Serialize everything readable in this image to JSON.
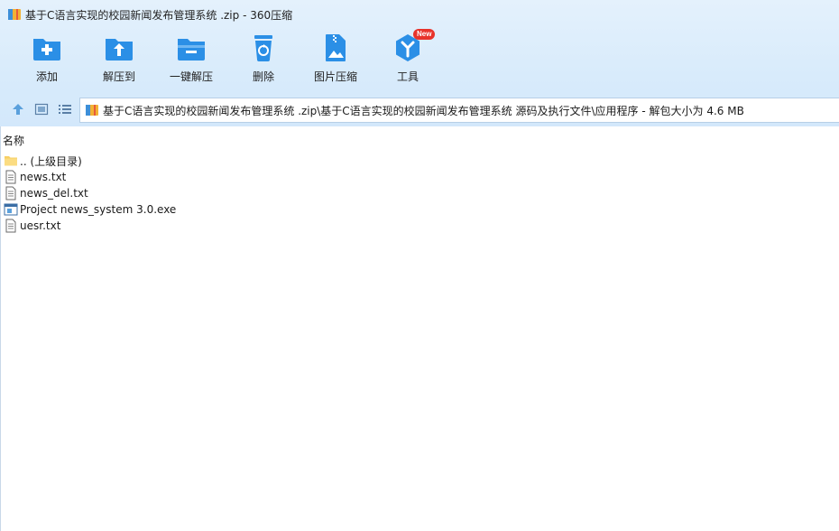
{
  "window": {
    "title": "基于C语言实现的校园新闻发布管理系统 .zip - 360压缩",
    "app_icon": "archive-app-icon"
  },
  "toolbar": {
    "items": [
      {
        "label": "添加",
        "icon": "add-folder-icon"
      },
      {
        "label": "解压到",
        "icon": "extract-to-icon"
      },
      {
        "label": "一键解压",
        "icon": "one-click-extract-icon"
      },
      {
        "label": "删除",
        "icon": "recycle-bin-icon"
      },
      {
        "label": "图片压缩",
        "icon": "image-compress-icon"
      },
      {
        "label": "工具",
        "icon": "tools-icon",
        "badge": "New"
      }
    ]
  },
  "nav": {
    "icons": [
      "up-arrow-icon",
      "view-thumbnail-icon",
      "view-list-icon"
    ],
    "path": "基于C语言实现的校园新闻发布管理系统 .zip\\基于C语言实现的校园新闻发布管理系统 源码及执行文件\\应用程序 - 解包大小为 4.6 MB"
  },
  "file_list": {
    "column_name": "名称",
    "items": [
      {
        "name": ".. (上级目录)",
        "icon": "folder-icon"
      },
      {
        "name": "news.txt",
        "icon": "text-file-icon"
      },
      {
        "name": "news_del.txt",
        "icon": "text-file-icon"
      },
      {
        "name": "Project news_system 3.0.exe",
        "icon": "exe-file-icon"
      },
      {
        "name": "uesr.txt",
        "icon": "text-file-icon"
      }
    ]
  },
  "colors": {
    "accent": "#2b8fe6",
    "toolbar_bg": "#d8ebfb",
    "badge": "#e8332b"
  }
}
